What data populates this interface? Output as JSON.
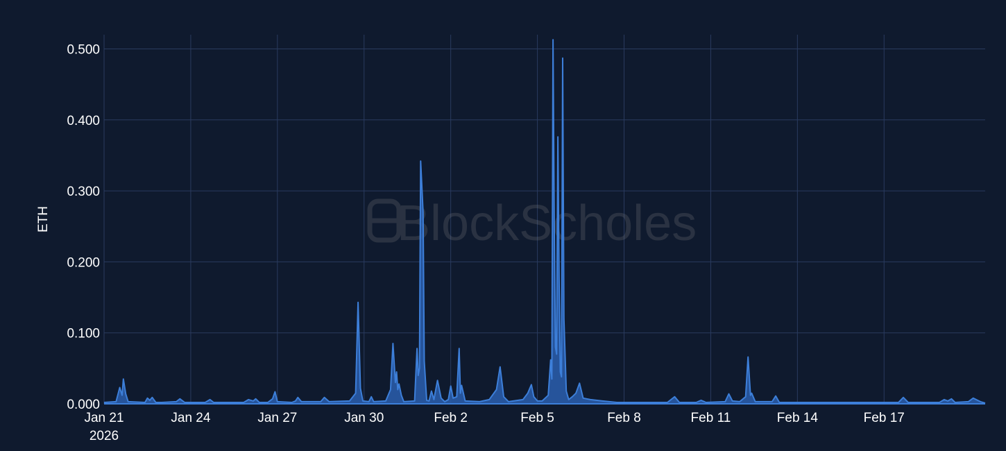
{
  "watermark": "BlockScholes",
  "chart_data": {
    "type": "area",
    "ylabel": "ETH",
    "xlabel": "",
    "title": "",
    "ylim": [
      0,
      0.52
    ],
    "xlim": [
      "2026-01-21",
      "2026-02-20"
    ],
    "yticks": [
      0,
      0.1,
      0.2,
      0.3,
      0.4,
      0.5
    ],
    "ytick_labels": [
      "0.000",
      "0.100",
      "0.200",
      "0.300",
      "0.400",
      "0.500"
    ],
    "xticks": [
      {
        "date": "2026-01-21",
        "label": "Jan 21",
        "sublabel": "2026"
      },
      {
        "date": "2026-01-24",
        "label": "Jan 24"
      },
      {
        "date": "2026-01-27",
        "label": "Jan 27"
      },
      {
        "date": "2026-01-30",
        "label": "Jan 30"
      },
      {
        "date": "2026-02-02",
        "label": "Feb 2"
      },
      {
        "date": "2026-02-05",
        "label": "Feb 5"
      },
      {
        "date": "2026-02-08",
        "label": "Feb 8"
      },
      {
        "date": "2026-02-11",
        "label": "Feb 11"
      },
      {
        "date": "2026-02-14",
        "label": "Feb 14"
      },
      {
        "date": "2026-02-17",
        "label": "Feb 17"
      }
    ],
    "grid": true,
    "colors": {
      "line": "#3d7fd9",
      "fill": "#2a5fae",
      "background": "#0f1a2e",
      "grid": "#2a3b5f"
    },
    "series": [
      {
        "points": [
          [
            "2026-01-21T00:00",
            0.002
          ],
          [
            "2026-01-21T10:00",
            0.003
          ],
          [
            "2026-01-21T13:00",
            0.023
          ],
          [
            "2026-01-21T15:00",
            0.012
          ],
          [
            "2026-01-21T16:00",
            0.035
          ],
          [
            "2026-01-21T18:00",
            0.014
          ],
          [
            "2026-01-21T20:00",
            0.003
          ],
          [
            "2026-01-22T10:00",
            0.002
          ],
          [
            "2026-01-22T12:00",
            0.008
          ],
          [
            "2026-01-22T14:00",
            0.005
          ],
          [
            "2026-01-22T16:00",
            0.009
          ],
          [
            "2026-01-22T19:00",
            0.002
          ],
          [
            "2026-01-23T00:00",
            0.002
          ],
          [
            "2026-01-23T12:00",
            0.003
          ],
          [
            "2026-01-23T15:00",
            0.007
          ],
          [
            "2026-01-23T19:00",
            0.002
          ],
          [
            "2026-01-24T12:00",
            0.002
          ],
          [
            "2026-01-24T16:00",
            0.006
          ],
          [
            "2026-01-24T19:00",
            0.002
          ],
          [
            "2026-01-25T20:00",
            0.002
          ],
          [
            "2026-01-26T00:00",
            0.006
          ],
          [
            "2026-01-26T04:00",
            0.004
          ],
          [
            "2026-01-26T06:00",
            0.007
          ],
          [
            "2026-01-26T09:00",
            0.002
          ],
          [
            "2026-01-26T16:00",
            0.002
          ],
          [
            "2026-01-26T20:00",
            0.007
          ],
          [
            "2026-01-26T22:00",
            0.017
          ],
          [
            "2026-01-27T00:00",
            0.003
          ],
          [
            "2026-01-27T12:00",
            0.002
          ],
          [
            "2026-01-27T15:00",
            0.004
          ],
          [
            "2026-01-27T17:00",
            0.009
          ],
          [
            "2026-01-27T20:00",
            0.003
          ],
          [
            "2026-01-28T12:00",
            0.003
          ],
          [
            "2026-01-28T15:00",
            0.009
          ],
          [
            "2026-01-28T19:00",
            0.003
          ],
          [
            "2026-01-29T12:00",
            0.004
          ],
          [
            "2026-01-29T17:00",
            0.015
          ],
          [
            "2026-01-29T19:00",
            0.143
          ],
          [
            "2026-01-29T21:00",
            0.022
          ],
          [
            "2026-01-29T23:00",
            0.004
          ],
          [
            "2026-01-30T04:00",
            0.003
          ],
          [
            "2026-01-30T06:00",
            0.01
          ],
          [
            "2026-01-30T08:00",
            0.003
          ],
          [
            "2026-01-30T18:00",
            0.004
          ],
          [
            "2026-01-30T22:00",
            0.02
          ],
          [
            "2026-01-31T00:00",
            0.085
          ],
          [
            "2026-01-31T02:00",
            0.03
          ],
          [
            "2026-01-31T03:00",
            0.045
          ],
          [
            "2026-01-31T04:00",
            0.02
          ],
          [
            "2026-01-31T05:00",
            0.028
          ],
          [
            "2026-01-31T07:00",
            0.012
          ],
          [
            "2026-01-31T09:00",
            0.003
          ],
          [
            "2026-01-31T18:00",
            0.004
          ],
          [
            "2026-01-31T20:00",
            0.078
          ],
          [
            "2026-01-31T21:00",
            0.04
          ],
          [
            "2026-01-31T22:00",
            0.05
          ],
          [
            "2026-01-31T23:00",
            0.342
          ],
          [
            "2026-02-01T01:00",
            0.27
          ],
          [
            "2026-02-01T02:00",
            0.06
          ],
          [
            "2026-02-01T04:00",
            0.005
          ],
          [
            "2026-02-01T06:00",
            0.004
          ],
          [
            "2026-02-01T08:00",
            0.018
          ],
          [
            "2026-02-01T10:00",
            0.006
          ],
          [
            "2026-02-01T13:00",
            0.033
          ],
          [
            "2026-02-01T16:00",
            0.008
          ],
          [
            "2026-02-01T19:00",
            0.003
          ],
          [
            "2026-02-01T22:00",
            0.006
          ],
          [
            "2026-02-02T00:00",
            0.025
          ],
          [
            "2026-02-02T02:00",
            0.008
          ],
          [
            "2026-02-02T05:00",
            0.01
          ],
          [
            "2026-02-02T07:00",
            0.078
          ],
          [
            "2026-02-02T08:00",
            0.015
          ],
          [
            "2026-02-02T09:00",
            0.026
          ],
          [
            "2026-02-02T12:00",
            0.004
          ],
          [
            "2026-02-03T00:00",
            0.003
          ],
          [
            "2026-02-03T08:00",
            0.006
          ],
          [
            "2026-02-03T14:00",
            0.02
          ],
          [
            "2026-02-03T17:00",
            0.052
          ],
          [
            "2026-02-03T20:00",
            0.01
          ],
          [
            "2026-02-04T00:00",
            0.003
          ],
          [
            "2026-02-04T12:00",
            0.006
          ],
          [
            "2026-02-04T16:00",
            0.015
          ],
          [
            "2026-02-04T19:00",
            0.027
          ],
          [
            "2026-02-04T21:00",
            0.01
          ],
          [
            "2026-02-05T00:00",
            0.004
          ],
          [
            "2026-02-05T04:00",
            0.004
          ],
          [
            "2026-02-05T09:00",
            0.012
          ],
          [
            "2026-02-05T11:00",
            0.062
          ],
          [
            "2026-02-05T12:00",
            0.035
          ],
          [
            "2026-02-05T13:00",
            0.513
          ],
          [
            "2026-02-05T14:00",
            0.25
          ],
          [
            "2026-02-05T15:00",
            0.08
          ],
          [
            "2026-02-05T16:00",
            0.07
          ],
          [
            "2026-02-05T17:00",
            0.376
          ],
          [
            "2026-02-05T18:00",
            0.18
          ],
          [
            "2026-02-05T19:00",
            0.045
          ],
          [
            "2026-02-05T20:00",
            0.038
          ],
          [
            "2026-02-05T21:00",
            0.487
          ],
          [
            "2026-02-05T22:00",
            0.12
          ],
          [
            "2026-02-06T00:00",
            0.018
          ],
          [
            "2026-02-06T02:00",
            0.006
          ],
          [
            "2026-02-06T05:00",
            0.01
          ],
          [
            "2026-02-06T08:00",
            0.015
          ],
          [
            "2026-02-06T11:00",
            0.029
          ],
          [
            "2026-02-06T14:00",
            0.008
          ],
          [
            "2026-02-06T20:00",
            0.006
          ],
          [
            "2026-02-07T06:00",
            0.004
          ],
          [
            "2026-02-07T18:00",
            0.002
          ],
          [
            "2026-02-09T12:00",
            0.002
          ],
          [
            "2026-02-09T18:00",
            0.01
          ],
          [
            "2026-02-09T22:00",
            0.002
          ],
          [
            "2026-02-10T12:00",
            0.002
          ],
          [
            "2026-02-10T16:00",
            0.005
          ],
          [
            "2026-02-10T20:00",
            0.002
          ],
          [
            "2026-02-11T12:00",
            0.003
          ],
          [
            "2026-02-11T15:00",
            0.014
          ],
          [
            "2026-02-11T18:00",
            0.004
          ],
          [
            "2026-02-12T00:00",
            0.003
          ],
          [
            "2026-02-12T05:00",
            0.01
          ],
          [
            "2026-02-12T07:00",
            0.066
          ],
          [
            "2026-02-12T09:00",
            0.012
          ],
          [
            "2026-02-12T10:00",
            0.015
          ],
          [
            "2026-02-12T13:00",
            0.003
          ],
          [
            "2026-02-13T03:00",
            0.003
          ],
          [
            "2026-02-13T06:00",
            0.011
          ],
          [
            "2026-02-13T09:00",
            0.002
          ],
          [
            "2026-02-17T12:00",
            0.002
          ],
          [
            "2026-02-17T16:00",
            0.009
          ],
          [
            "2026-02-17T20:00",
            0.002
          ],
          [
            "2026-02-18T22:00",
            0.002
          ],
          [
            "2026-02-19T02:00",
            0.006
          ],
          [
            "2026-02-19T05:00",
            0.004
          ],
          [
            "2026-02-19T08:00",
            0.007
          ],
          [
            "2026-02-19T11:00",
            0.002
          ],
          [
            "2026-02-19T22:00",
            0.003
          ],
          [
            "2026-02-20T02:00",
            0.008
          ],
          [
            "2026-02-20T08:00",
            0.003
          ],
          [
            "2026-02-20T12:00",
            0.001
          ]
        ]
      }
    ]
  }
}
